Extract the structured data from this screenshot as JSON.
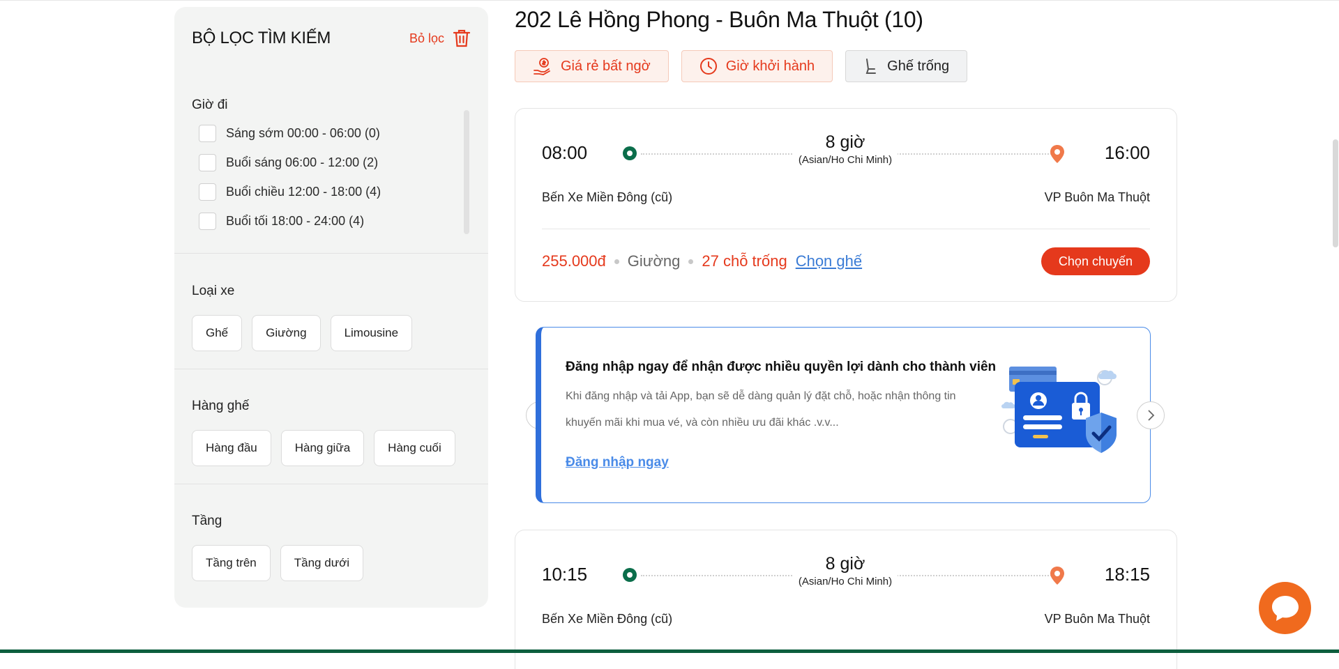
{
  "sidebar": {
    "title": "BỘ LỌC TÌM KIẾM",
    "clear_label": "Bỏ lọc",
    "departure_time": {
      "label": "Giờ đi",
      "options": [
        {
          "label": "Sáng sớm 00:00 - 06:00 (0)"
        },
        {
          "label": "Buổi sáng 06:00 - 12:00 (2)"
        },
        {
          "label": "Buổi chiều 12:00 - 18:00 (4)"
        },
        {
          "label": "Buổi tối 18:00 - 24:00 (4)"
        }
      ]
    },
    "vehicle_type": {
      "label": "Loại xe",
      "options": [
        "Ghế",
        "Giường",
        "Limousine"
      ]
    },
    "seat_row": {
      "label": "Hàng ghế",
      "options": [
        "Hàng đầu",
        "Hàng giữa",
        "Hàng cuối"
      ]
    },
    "floor": {
      "label": "Tầng",
      "options": [
        "Tầng trên",
        "Tầng dưới"
      ]
    }
  },
  "main": {
    "route_title": "202 Lê Hồng Phong - Buôn Ma Thuột (10)",
    "sort_buttons": [
      {
        "label": "Giá rẻ bất ngờ",
        "icon": "money-hand-icon"
      },
      {
        "label": "Giờ khởi hành",
        "icon": "clock-icon"
      },
      {
        "label": "Ghế trống",
        "icon": "seat-icon"
      }
    ],
    "trips": [
      {
        "depart": "08:00",
        "arrive": "16:00",
        "duration": "8 giờ",
        "timezone": "(Asian/Ho Chi Minh)",
        "from": "Bến Xe Miền Đông (cũ)",
        "to": "VP Buôn Ma Thuột",
        "price": "255.000đ",
        "type": "Giường",
        "seats": "27 chỗ trống",
        "pick_seat": "Chọn ghế",
        "choose": "Chọn chuyến"
      },
      {
        "depart": "10:15",
        "arrive": "18:15",
        "duration": "8 giờ",
        "timezone": "(Asian/Ho Chi Minh)",
        "from": "Bến Xe Miền Đông (cũ)",
        "to": "VP Buôn Ma Thuột"
      }
    ],
    "banner": {
      "title": "Đăng nhập ngay để nhận được nhiều quyền lợi dành cho thành viên",
      "desc": "Khi đăng nhập và tải App, bạn sẽ dễ dàng quản lý đặt chỗ, hoặc nhận thông tin khuyến mãi khi mua vé, và còn nhiều ưu đãi khác .v.v...",
      "link": "Đăng nhập ngay"
    }
  },
  "colors": {
    "accent": "#e5391c",
    "brand_green": "#0b6e4b",
    "link_blue": "#3a7bd5",
    "chat_orange": "#f06a1e"
  }
}
